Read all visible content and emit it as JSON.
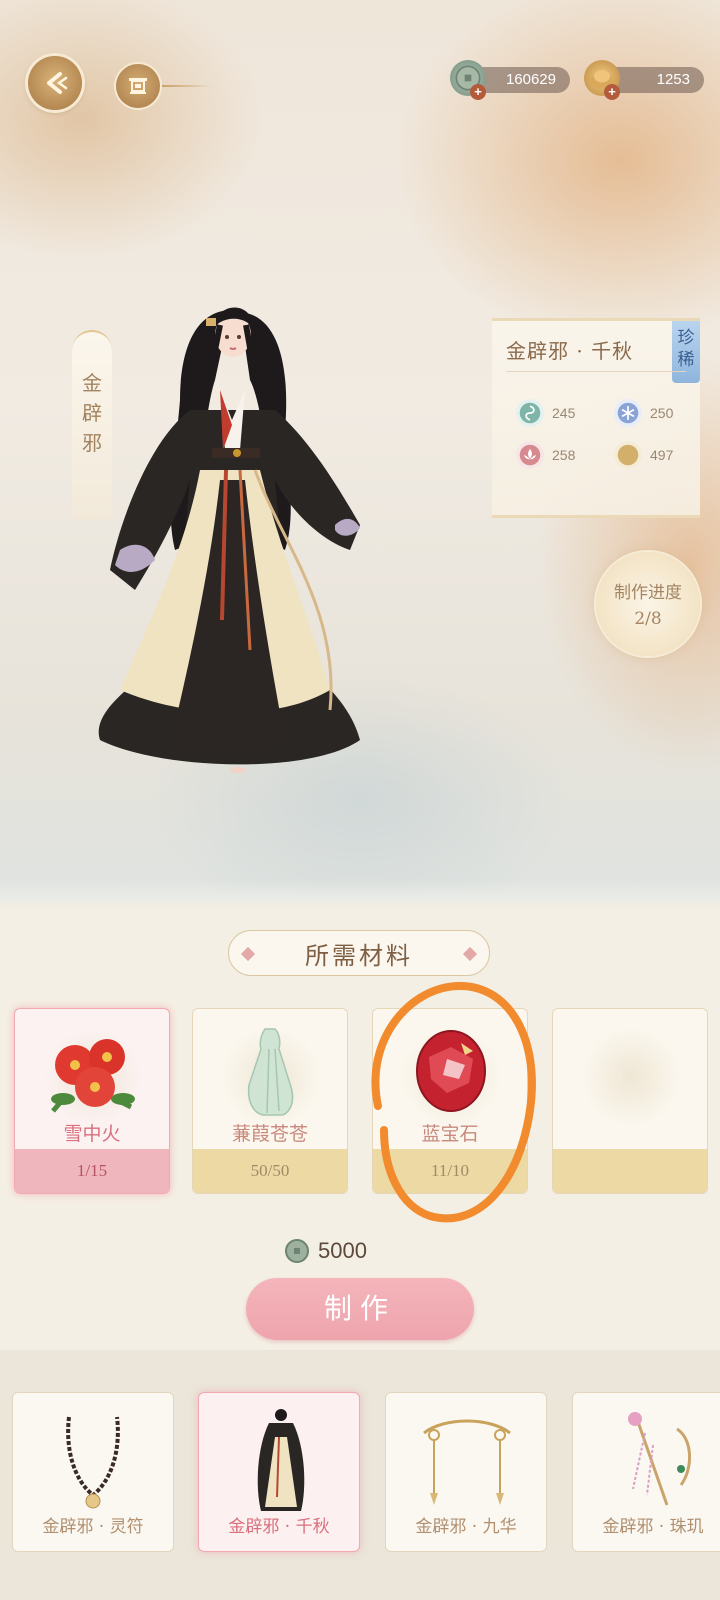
{
  "topbar": {
    "currency": [
      {
        "icon": "copper-coin-icon",
        "value": "160629"
      },
      {
        "icon": "gold-ingot-icon",
        "value": "1253"
      }
    ]
  },
  "outfit": {
    "vertical_name": [
      "金",
      "辟",
      "邪"
    ],
    "card_title": "金辟邪 · 千秋",
    "rarity": [
      "珍",
      "稀"
    ],
    "stats": [
      {
        "icon": "green-swirl-icon",
        "value": "245",
        "color": "#7fb5a8"
      },
      {
        "icon": "blue-snowflake-icon",
        "value": "250",
        "color": "#8aa3d6"
      },
      {
        "icon": "red-lotus-icon",
        "value": "258",
        "color": "#d6898f"
      },
      {
        "icon": "gold-moon-icon",
        "value": "497",
        "color": "#d3b06a"
      }
    ],
    "progress_label": "制作进度",
    "progress_value": "2/8"
  },
  "materials": {
    "header": "所需材料",
    "items": [
      {
        "name": "雪中火",
        "count": "1/15"
      },
      {
        "name": "蒹葭苍苍",
        "count": "50/50"
      },
      {
        "name": "蓝宝石",
        "count": "11/10"
      },
      {
        "name": "",
        "count": ""
      }
    ],
    "cost": "5000",
    "make_label": "制作"
  },
  "set_items": [
    {
      "name": "金辟邪 · 灵符"
    },
    {
      "name": "金辟邪 · 千秋"
    },
    {
      "name": "金辟邪 · 九华"
    },
    {
      "name": "金辟邪 · 珠玑"
    }
  ],
  "colors": {
    "accent_pink": "#eea4ad",
    "gold": "#d9b37b",
    "annotation_orange": "#f28a2e"
  }
}
